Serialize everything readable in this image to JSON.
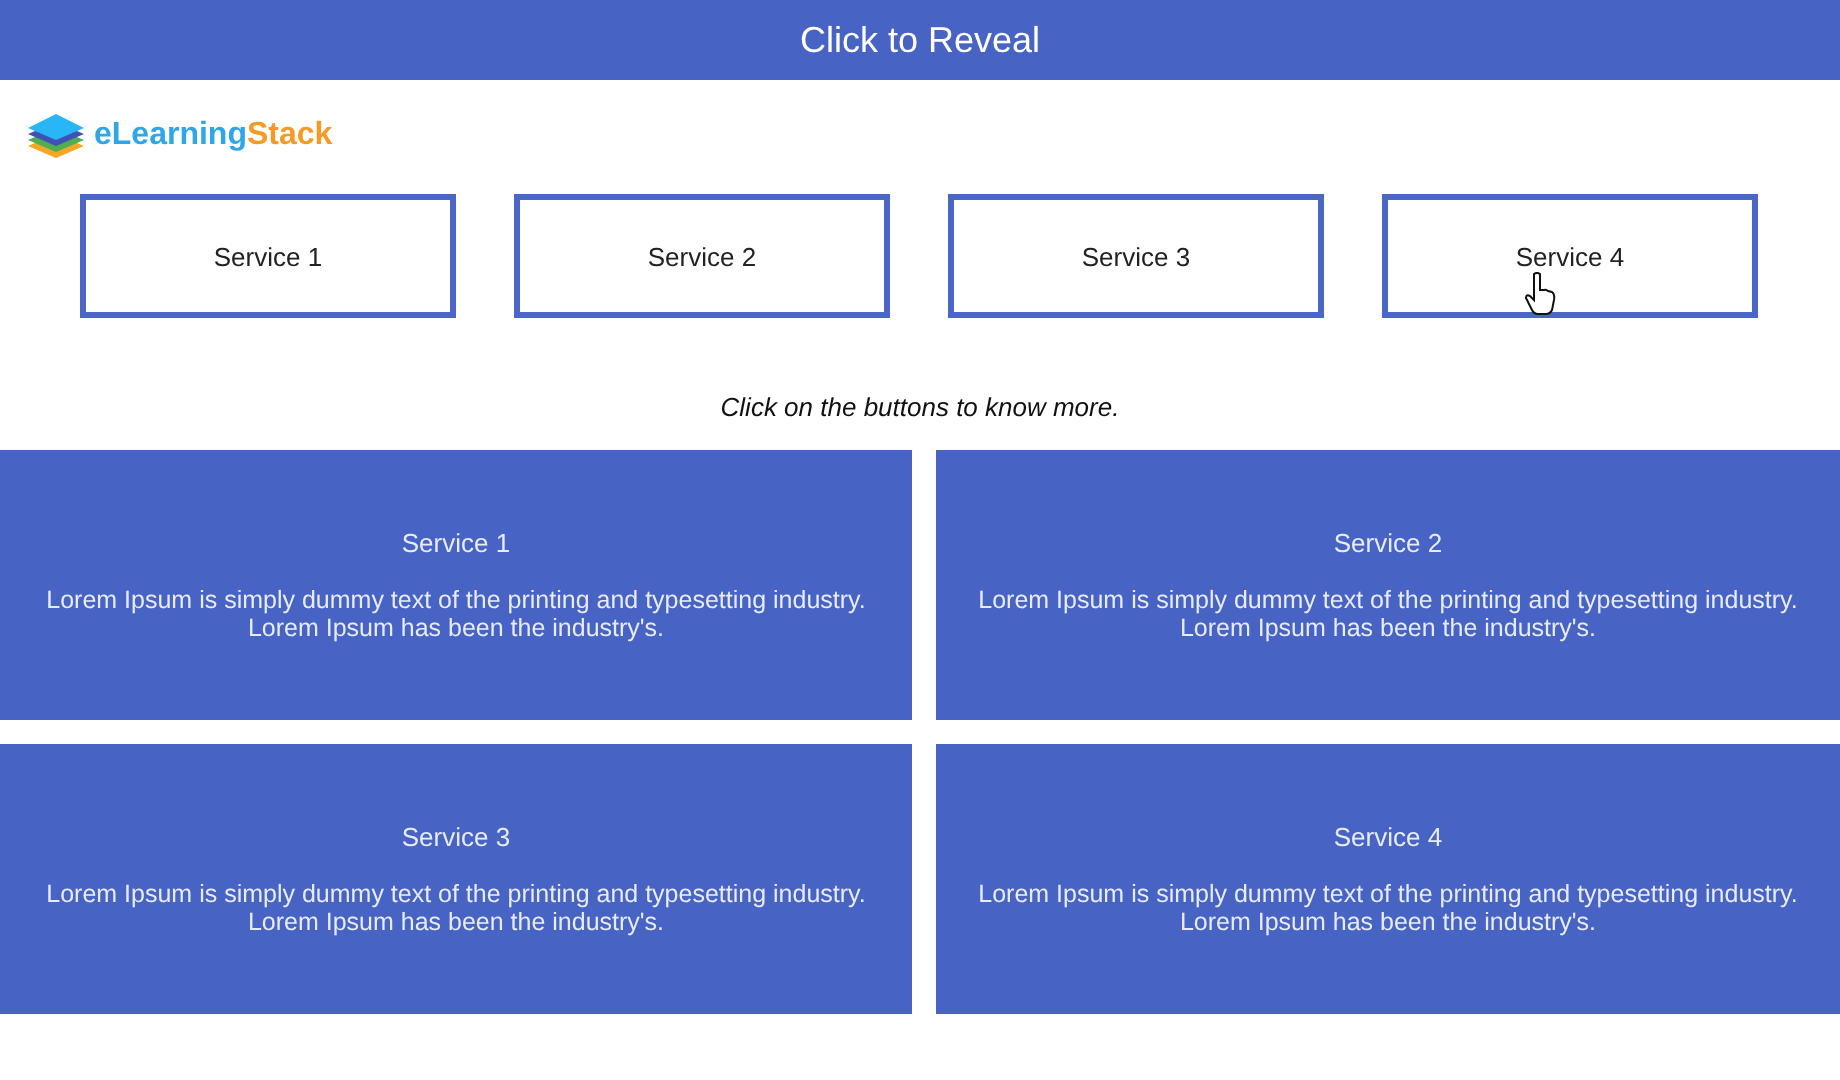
{
  "header": {
    "title": "Click to Reveal"
  },
  "logo": {
    "part1": "eLearning",
    "part2": "Stack"
  },
  "buttons": [
    {
      "label": "Service 1",
      "hovered": false
    },
    {
      "label": "Service 2",
      "hovered": false
    },
    {
      "label": "Service 3",
      "hovered": false
    },
    {
      "label": "Service 4",
      "hovered": true
    }
  ],
  "instruction": "Click on the buttons to know more.",
  "cards": [
    {
      "title": "Service 1",
      "text": "Lorem Ipsum is simply dummy text of the printing and typesetting industry. Lorem Ipsum has been the industry's."
    },
    {
      "title": "Service 2",
      "text": "Lorem Ipsum is simply dummy text of the printing and typesetting industry. Lorem Ipsum has been the industry's."
    },
    {
      "title": "Service 3",
      "text": "Lorem Ipsum is simply dummy text of the printing and typesetting industry. Lorem Ipsum has been the industry's."
    },
    {
      "title": "Service 4",
      "text": "Lorem Ipsum is simply dummy text of the printing and typesetting industry. Lorem Ipsum has been the industry's."
    }
  ]
}
